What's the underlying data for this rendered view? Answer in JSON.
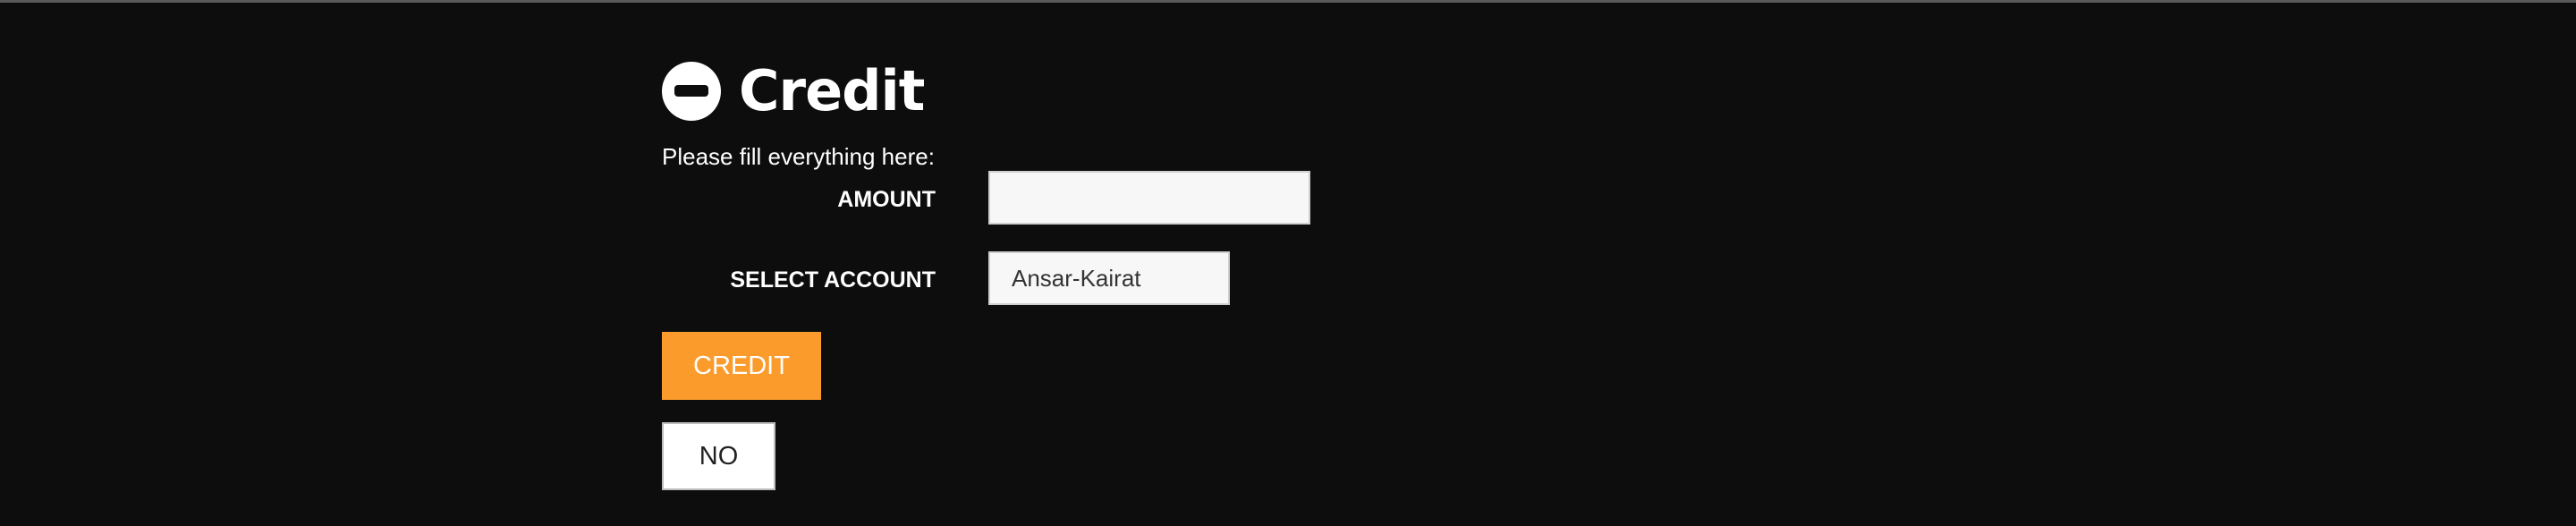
{
  "page": {
    "title": "Credit",
    "title_icon": "minus-circle-icon",
    "instructions": "Please fill everything here:"
  },
  "form": {
    "amount_label": "AMOUNT",
    "amount_value": "",
    "account_label": "SELECT ACCOUNT",
    "account_selected": "Ansar-Kairat"
  },
  "actions": {
    "credit_label": "CREDIT",
    "no_label": "NO"
  },
  "colors": {
    "background": "#0d0d0d",
    "accent": "#fb9b2c",
    "input_bg": "#f7f7f7"
  }
}
